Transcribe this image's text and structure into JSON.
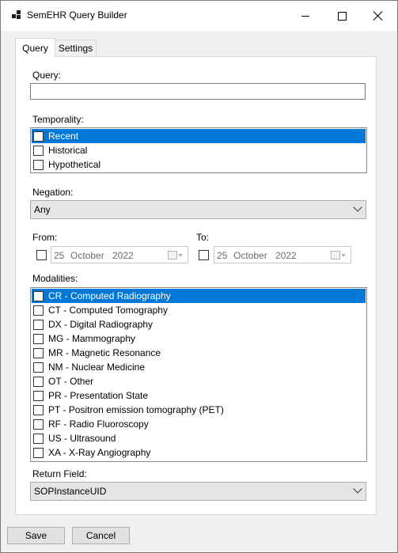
{
  "window": {
    "title": "SemEHR Query Builder"
  },
  "tabs": [
    {
      "label": "Query"
    },
    {
      "label": "Settings"
    }
  ],
  "query": {
    "label": "Query:",
    "value": ""
  },
  "temporality": {
    "label": "Temporality:",
    "items": [
      {
        "label": "Recent",
        "checked": false,
        "selected": true
      },
      {
        "label": "Historical",
        "checked": false,
        "selected": false
      },
      {
        "label": "Hypothetical",
        "checked": false,
        "selected": false
      }
    ]
  },
  "negation": {
    "label": "Negation:",
    "value": "Any"
  },
  "from": {
    "label": "From:",
    "day": "25",
    "month": "October",
    "year": "2022",
    "enabled": false
  },
  "to": {
    "label": "To:",
    "day": "25",
    "month": "October",
    "year": "2022",
    "enabled": false
  },
  "modalities": {
    "label": "Modalities:",
    "items": [
      {
        "label": "CR - Computed Radiography",
        "selected": true
      },
      {
        "label": "CT - Computed Tomography",
        "selected": false
      },
      {
        "label": "DX - Digital Radiography",
        "selected": false
      },
      {
        "label": "MG - Mammography",
        "selected": false
      },
      {
        "label": "MR - Magnetic Resonance",
        "selected": false
      },
      {
        "label": "NM - Nuclear Medicine",
        "selected": false
      },
      {
        "label": "OT - Other",
        "selected": false
      },
      {
        "label": "PR - Presentation State",
        "selected": false
      },
      {
        "label": "PT - Positron emission tomography (PET)",
        "selected": false
      },
      {
        "label": "RF - Radio Fluoroscopy",
        "selected": false
      },
      {
        "label": "US - Ultrasound",
        "selected": false
      },
      {
        "label": "XA - X-Ray Angiography",
        "selected": false
      }
    ]
  },
  "return_field": {
    "label": "Return Field:",
    "value": "SOPInstanceUID"
  },
  "buttons": {
    "save": "Save",
    "cancel": "Cancel"
  },
  "colors": {
    "selection": "#0078d7",
    "title_bar": "#ffffff",
    "background": "#f0f0f0"
  }
}
